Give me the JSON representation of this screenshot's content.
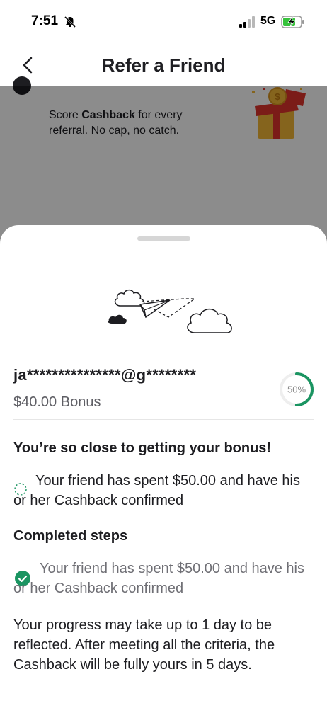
{
  "status_bar": {
    "time": "7:51",
    "network": "5G",
    "icons": [
      "bell-slash-icon",
      "signal-icon",
      "battery-charging-icon"
    ]
  },
  "nav": {
    "title": "Refer a Friend",
    "back_icon": "chevron-left-icon"
  },
  "background_card": {
    "text_prefix": "Score ",
    "text_bold": "Cashback",
    "text_suffix": " for every referral. No cap, no catch.",
    "icon": "gift-box-icon"
  },
  "sheet": {
    "illustration_icon": "paper-plane-clouds-icon",
    "referral": {
      "email": "ja***************@g********",
      "bonus": "$40.00 Bonus",
      "progress_label": "50%",
      "progress_value": 0.5
    },
    "close_heading": "You’re so close to getting your bonus!",
    "pending_steps": [
      {
        "text": "Your friend has spent $50.00 and have his or her Cashback confirmed"
      }
    ],
    "completed_heading": "Completed steps",
    "completed_steps": [
      {
        "text": "Your friend has spent $50.00 and have his or her Cashback confirmed"
      }
    ],
    "note": "Your progress may take up to 1 day to be reflected. After meeting all the criteria, the Cashback will be fully yours in 5 days."
  },
  "colors": {
    "accent_green": "#1a9461",
    "overlay": "#000000",
    "gift_red": "#e0342d",
    "gift_gold": "#f2b636"
  }
}
